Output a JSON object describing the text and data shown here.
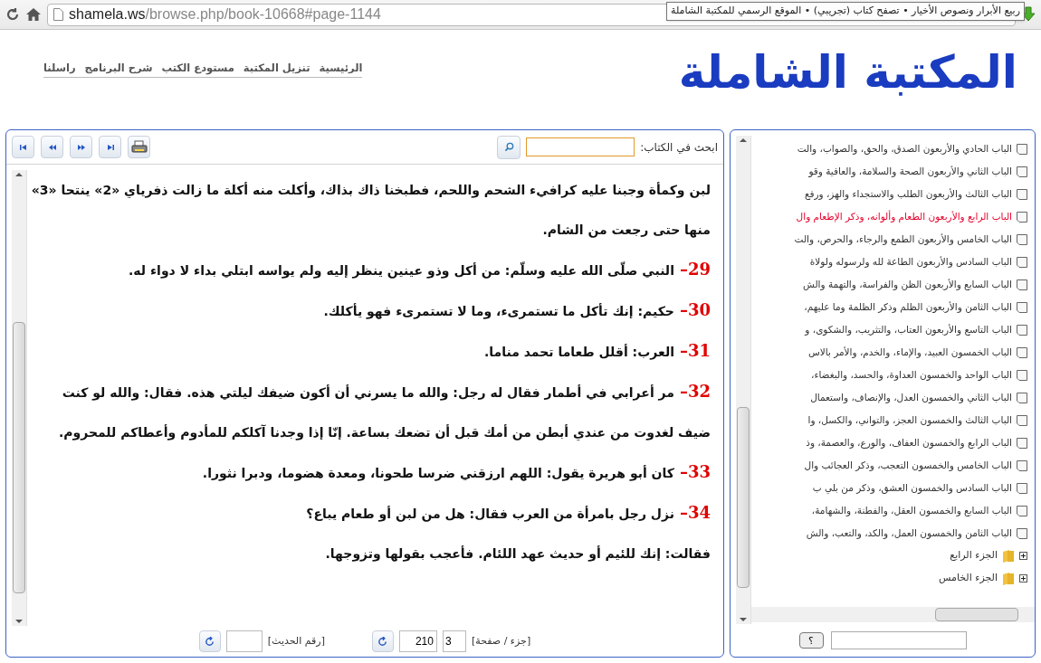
{
  "browser": {
    "url_host": "shamela.ws",
    "url_path": "/browse.php/book-10668#page-1144",
    "tooltip": "ربيع الأبرار ونصوص الأخيار • تصفح كتاب (تجريبي) • الموقع الرسمي للمكتبة الشاملة"
  },
  "header": {
    "logo": "المكتبة الشاملة",
    "nav": [
      "الرئيسية",
      "تنزيل المكتبة",
      "مستودع الكتب",
      "شرح البرنامج",
      "راسلنا"
    ]
  },
  "reader": {
    "search_label": "ابحث في الكتاب:",
    "entries": [
      {
        "text": "لبن وكمأة وجبنا عليه كرافيء الشحم واللحم، فطبخنا ذاك بذاك، وأكلت منه أكلة ما زالت ذفرياي «2» ينتحا «3» منها حتى رجعت من الشام."
      },
      {
        "number": "–29",
        "text": "النبي صلّى الله عليه وسلّم: من أكل وذو عينين ينظر إليه ولم يواسه ابتلي بداء لا دواء له."
      },
      {
        "number": "–30",
        "text": "حكيم: إنك تأكل ما تستمرىء، وما لا تستمرىء فهو يأكلك."
      },
      {
        "number": "–31",
        "text": "العرب: أقلل طعاما تحمد مناما."
      },
      {
        "number": "–32",
        "text": "مر أعرابي في أطمار فقال له رجل: والله ما يسرني أن أكون ضيفك ليلتي هذه. فقال: والله لو كنت ضيف لغدوت من عندي أبطن من أمك قبل أن تضعك بساعة. إنّا إذا وجدنا آكلكم للمأدوم وأعطاكم للمحروم."
      },
      {
        "number": "–33",
        "text": "كان أبو هريرة يقول: اللهم ارزقني ضرسا طحونا، ومعدة هضوما، ودبرا نثورا."
      },
      {
        "number": "–34",
        "text": "نزل رجل بامرأة من العرب فقال: هل من لبن أو طعام يباع؟"
      },
      {
        "text": "فقالت: إنك للئيم أو حديث عهد اللئام. فأعجب بقولها وتزوجها."
      }
    ],
    "page_label": "[جزء / صفحة]",
    "part": "3",
    "page": "210",
    "hadith_label": "[رقم الحديث]"
  },
  "tree": {
    "items": [
      {
        "label": "الباب الحادي والأربعون الصدق، والحق، والصواب، والت",
        "selected": false
      },
      {
        "label": "الباب الثاني والأربعون الصحة والسلامة، والعافية وقو",
        "selected": false
      },
      {
        "label": "الباب الثالث والأربعون الطلب والاستجداء والهز، ورفع",
        "selected": false
      },
      {
        "label": "الباب الرابع والأربعون الطعام وألوانه، وذكر الإطعام وال",
        "selected": true
      },
      {
        "label": "الباب الخامس والأربعون الطمع والرجاء، والحرص، والت",
        "selected": false
      },
      {
        "label": "الباب السادس والأربعون الطاعة لله ولرسوله ولولاة",
        "selected": false
      },
      {
        "label": "الباب السابع والأربعون الظن والفراسة، والتهمة والش",
        "selected": false
      },
      {
        "label": "الباب الثامن والأربعون الظلم وذكر الظلمة وما عليهم،",
        "selected": false
      },
      {
        "label": "الباب التاسع والأربعون العتاب، والتثريب، والشكوى، و",
        "selected": false
      },
      {
        "label": "الباب الخمسون العبيد، والإماء، والخدم، والأمر بالاس",
        "selected": false
      },
      {
        "label": "الباب الواحد والخمسون العداوة، والحسد، والبغضاء،",
        "selected": false
      },
      {
        "label": "الباب الثاني والخمسون العدل، والإنصاف، واستعمال",
        "selected": false
      },
      {
        "label": "الباب الثالث والخمسون العجز، والتواني، والكسل، وا",
        "selected": false
      },
      {
        "label": "الباب الرابع والخمسون العفاف، والورع، والعصمة، وذ",
        "selected": false
      },
      {
        "label": "الباب الخامس والخمسون التعجب، وذكر العجائب وال",
        "selected": false
      },
      {
        "label": "الباب السادس والخمسون العشق، وذكر من بلي ب",
        "selected": false
      },
      {
        "label": "الباب السابع والخمسون العقل، والفطنة، والشهامة،",
        "selected": false
      },
      {
        "label": "الباب الثامن والخمسون العمل، والكد، والتعب، والش",
        "selected": false
      }
    ],
    "folders": [
      {
        "label": "الجزء الرابع",
        "expanded": false
      },
      {
        "label": "الجزء الخامس",
        "expanded": false
      }
    ],
    "help_button": "؟"
  }
}
